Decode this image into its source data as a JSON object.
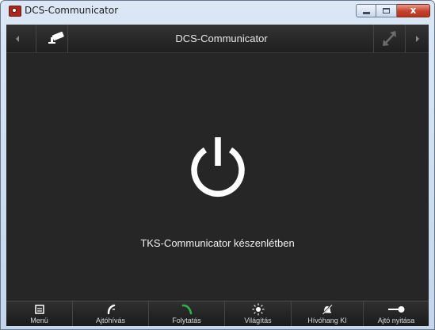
{
  "window": {
    "title": "DCS-Communicator",
    "close_glyph": "x"
  },
  "topbar": {
    "title": "DCS-Communicator",
    "left_icon": "camera-icon",
    "right_icon": "expand-icon"
  },
  "main": {
    "power_icon": "power-icon",
    "status_text": "TKS-Communicator készenlétben"
  },
  "bottombar": {
    "items": [
      {
        "label": "Menü",
        "icon": "menu-icon"
      },
      {
        "label": "Ajtóhívás",
        "icon": "door-call-icon"
      },
      {
        "label": "Folytatás",
        "icon": "continue-call-icon"
      },
      {
        "label": "Világítás",
        "icon": "light-icon"
      },
      {
        "label": "Hívóhang KI",
        "icon": "ringtone-off-icon"
      },
      {
        "label": "Ajtó nyitása",
        "icon": "door-open-key-icon"
      }
    ]
  },
  "colors": {
    "client_bg": "#262626",
    "continue_green": "#2fb34a",
    "text": "#f0f0f0"
  }
}
